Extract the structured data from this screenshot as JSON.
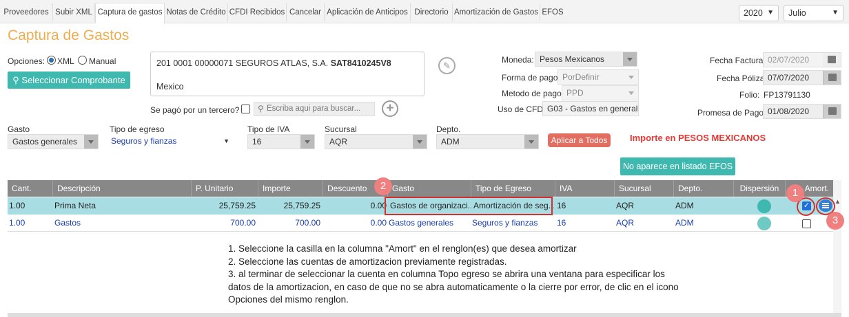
{
  "nav": {
    "tabs": [
      "Proveedores",
      "Subir XML",
      "Captura de gastos",
      "Notas de Crédito",
      "CFDI Recibidos",
      "Cancelar",
      "Aplicación de Anticipos",
      "Directorio",
      "Amortización de Gastos",
      "EFOS"
    ],
    "active_tab": "Captura de gastos",
    "year": "2020",
    "month": "Julio"
  },
  "page_title": "Captura de Gastos",
  "options": {
    "label": "Opciones:",
    "xml": "XML",
    "manual": "Manual",
    "select_button": "Seleccionar Comprobante"
  },
  "provider": {
    "line1_prefix": "201 0001 00000071 SEGUROS ATLAS, S.A.",
    "rfc": "SAT8410245V8",
    "country": "Mexico"
  },
  "third_party": {
    "label": "Se pagó por un tercero?",
    "search_placeholder": "Escriba aqui para buscar..."
  },
  "payment": {
    "moneda_label": "Moneda:",
    "moneda_value": "Pesos Mexicanos",
    "forma_label": "Forma de pago",
    "forma_value": "PorDefinir",
    "metodo_label": "Metodo de pago:",
    "metodo_value": "PPD",
    "uso_label": "Uso de CFDI",
    "uso_value": "G03 - Gastos en general"
  },
  "dates": {
    "factura_label": "Fecha Factura:",
    "factura_value": "02/07/2020",
    "poliza_label": "Fecha Póliza",
    "poliza_value": "07/07/2020",
    "folio_label": "Folio:",
    "folio_value": "FP13791130",
    "promesa_label": "Promesa de Pago:",
    "promesa_value": "01/08/2020"
  },
  "filters": {
    "gasto_label": "Gasto",
    "gasto_value": "Gastos generales",
    "tipo_label": "Tipo de egreso",
    "tipo_value": "Seguros y fianzas",
    "iva_label": "Tipo de IVA",
    "iva_value": "16",
    "sucursal_label": "Sucursal",
    "sucursal_value": "AQR",
    "depto_label": "Depto.",
    "depto_value": "ADM",
    "apply_all": "Aplicar a Todos",
    "importe_notice": "Importe en PESOS MEXICANOS",
    "efos_button": "No aparece en listado EFOS"
  },
  "grid": {
    "headers": [
      "Cant.",
      "Descripción",
      "P. Unitario",
      "Importe",
      "Descuento",
      "Gasto",
      "Tipo de Egreso",
      "IVA",
      "Sucursal",
      "Depto.",
      "Dispersión",
      "Amort."
    ],
    "rows": [
      {
        "cant": "1.00",
        "desc": "Prima Neta",
        "punit": "25,759.25",
        "importe": "25,759.25",
        "descuento": "0.00",
        "gasto": "Gastos de organizaci...",
        "tipo": "Amortización de seg...",
        "iva": "16",
        "sucursal": "AQR",
        "depto": "ADM",
        "amort_checked": true
      },
      {
        "cant": "1.00",
        "desc": "Gastos",
        "punit": "700.00",
        "importe": "700.00",
        "descuento": "0.00",
        "gasto": "Gastos generales",
        "tipo": "Seguros y fianzas",
        "iva": "16",
        "sucursal": "AQR",
        "depto": "ADM",
        "amort_checked": false
      }
    ]
  },
  "badges": {
    "b1": "1",
    "b2": "2",
    "b3": "3"
  },
  "instructions": [
    "1. Seleccione la casilla en la columna \"Amort\" en el renglon(es) que desea amortizar",
    "2. Seleccione las cuentas de amortizacion previamente registradas.",
    "3. al terminar de seleccionar la cuenta en columna Topo egreso se abrira una ventana para especificar los datos de la amortizacion, en caso de que no se abra automaticamente o la cierre por error, de clic en el icono Opciones del mismo renglon."
  ],
  "colors": {
    "accent": "#f0ad4e",
    "teal": "#3fb8af",
    "red": "#d32f2f",
    "notice": "#e53935"
  }
}
